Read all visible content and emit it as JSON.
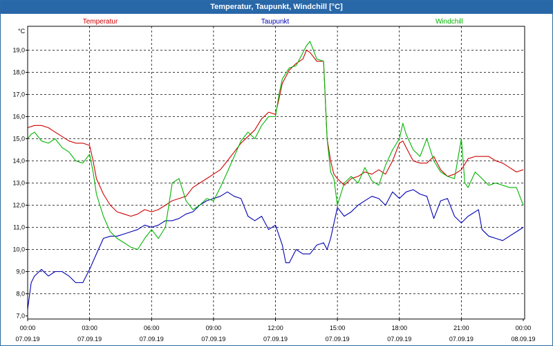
{
  "window": {
    "title": "Temperatur, Taupunkt, Windchill [°C]"
  },
  "chart_data": {
    "type": "line",
    "title": "Temperatur, Taupunkt, Windchill [°C]",
    "ylabel": "°C",
    "ylim": [
      7.0,
      19.5
    ],
    "xlim": [
      0,
      24
    ],
    "grid": true,
    "legend_position": "top",
    "y_ticks": [
      "7,0",
      "8,0",
      "9,0",
      "10,0",
      "11,0",
      "12,0",
      "13,0",
      "14,0",
      "15,0",
      "16,0",
      "17,0",
      "18,0",
      "19,0"
    ],
    "x_ticks": [
      {
        "t": "00:00",
        "d": "07.09.19"
      },
      {
        "t": "03:00",
        "d": "07.09.19"
      },
      {
        "t": "06:00",
        "d": "07.09.19"
      },
      {
        "t": "09:00",
        "d": "07.09.19"
      },
      {
        "t": "12:00",
        "d": "07.09.19"
      },
      {
        "t": "15:00",
        "d": "07.09.19"
      },
      {
        "t": "18:00",
        "d": "07.09.19"
      },
      {
        "t": "21:00",
        "d": "07.09.19"
      },
      {
        "t": "00:00",
        "d": "08.09.19"
      }
    ],
    "series": [
      {
        "name": "Temperatur",
        "color": "#cc0000",
        "points": [
          [
            0,
            15.5
          ],
          [
            0.33,
            15.6
          ],
          [
            0.67,
            15.6
          ],
          [
            1,
            15.5
          ],
          [
            1.33,
            15.3
          ],
          [
            1.67,
            15.1
          ],
          [
            2,
            14.9
          ],
          [
            2.33,
            14.8
          ],
          [
            2.67,
            14.8
          ],
          [
            3,
            14.7
          ],
          [
            3.17,
            14.0
          ],
          [
            3.33,
            13.2
          ],
          [
            3.67,
            12.5
          ],
          [
            4,
            12.0
          ],
          [
            4.33,
            11.7
          ],
          [
            4.67,
            11.6
          ],
          [
            5,
            11.5
          ],
          [
            5.33,
            11.6
          ],
          [
            5.67,
            11.8
          ],
          [
            6,
            11.7
          ],
          [
            6.33,
            11.8
          ],
          [
            6.67,
            12.0
          ],
          [
            7,
            12.2
          ],
          [
            7.33,
            12.3
          ],
          [
            7.67,
            12.4
          ],
          [
            8,
            12.8
          ],
          [
            8.33,
            13.0
          ],
          [
            8.67,
            13.2
          ],
          [
            9,
            13.4
          ],
          [
            9.33,
            13.6
          ],
          [
            9.67,
            14.0
          ],
          [
            10,
            14.4
          ],
          [
            10.33,
            14.8
          ],
          [
            10.67,
            15.1
          ],
          [
            11,
            15.4
          ],
          [
            11.33,
            15.9
          ],
          [
            11.67,
            16.2
          ],
          [
            12,
            16.1
          ],
          [
            12.17,
            16.8
          ],
          [
            12.33,
            17.5
          ],
          [
            12.67,
            18.1
          ],
          [
            13,
            18.4
          ],
          [
            13.33,
            18.6
          ],
          [
            13.5,
            19.0
          ],
          [
            13.67,
            18.9
          ],
          [
            14,
            18.5
          ],
          [
            14.33,
            18.5
          ],
          [
            14.5,
            15.0
          ],
          [
            14.67,
            14.0
          ],
          [
            14.83,
            13.4
          ],
          [
            15,
            13.2
          ],
          [
            15.33,
            12.9
          ],
          [
            15.67,
            13.2
          ],
          [
            16,
            13.3
          ],
          [
            16.33,
            13.5
          ],
          [
            16.67,
            13.4
          ],
          [
            17,
            13.6
          ],
          [
            17.33,
            13.4
          ],
          [
            17.67,
            14.0
          ],
          [
            18,
            14.8
          ],
          [
            18.17,
            14.9
          ],
          [
            18.33,
            14.6
          ],
          [
            18.67,
            14.0
          ],
          [
            19,
            13.9
          ],
          [
            19.33,
            13.9
          ],
          [
            19.67,
            14.2
          ],
          [
            20,
            13.6
          ],
          [
            20.33,
            13.3
          ],
          [
            20.67,
            13.4
          ],
          [
            21,
            13.6
          ],
          [
            21.33,
            14.1
          ],
          [
            21.67,
            14.2
          ],
          [
            22,
            14.2
          ],
          [
            22.33,
            14.2
          ],
          [
            22.67,
            14.0
          ],
          [
            23,
            13.9
          ],
          [
            23.33,
            13.7
          ],
          [
            23.67,
            13.5
          ],
          [
            24,
            13.6
          ]
        ]
      },
      {
        "name": "Taupunkt",
        "color": "#0000b4",
        "points": [
          [
            0,
            7.3
          ],
          [
            0.17,
            8.5
          ],
          [
            0.33,
            8.8
          ],
          [
            0.67,
            9.1
          ],
          [
            1,
            8.8
          ],
          [
            1.33,
            9.0
          ],
          [
            1.67,
            9.0
          ],
          [
            2,
            8.8
          ],
          [
            2.33,
            8.5
          ],
          [
            2.67,
            8.5
          ],
          [
            3,
            9.1
          ],
          [
            3.33,
            9.8
          ],
          [
            3.67,
            10.5
          ],
          [
            4,
            10.6
          ],
          [
            4.33,
            10.6
          ],
          [
            4.67,
            10.7
          ],
          [
            5,
            10.8
          ],
          [
            5.33,
            10.9
          ],
          [
            5.67,
            11.1
          ],
          [
            6,
            11.0
          ],
          [
            6.33,
            11.1
          ],
          [
            6.67,
            11.3
          ],
          [
            7,
            11.3
          ],
          [
            7.33,
            11.4
          ],
          [
            7.67,
            11.6
          ],
          [
            8,
            11.7
          ],
          [
            8.33,
            12.0
          ],
          [
            8.67,
            12.2
          ],
          [
            9,
            12.3
          ],
          [
            9.33,
            12.4
          ],
          [
            9.67,
            12.6
          ],
          [
            10,
            12.4
          ],
          [
            10.33,
            12.3
          ],
          [
            10.67,
            11.5
          ],
          [
            11,
            11.3
          ],
          [
            11.33,
            11.5
          ],
          [
            11.67,
            10.9
          ],
          [
            12,
            11.1
          ],
          [
            12.33,
            10.2
          ],
          [
            12.5,
            9.4
          ],
          [
            12.67,
            9.4
          ],
          [
            13,
            10.0
          ],
          [
            13.33,
            9.8
          ],
          [
            13.67,
            9.8
          ],
          [
            14,
            10.2
          ],
          [
            14.33,
            10.3
          ],
          [
            14.5,
            10.0
          ],
          [
            14.67,
            10.5
          ],
          [
            15,
            11.9
          ],
          [
            15.33,
            11.5
          ],
          [
            15.67,
            11.7
          ],
          [
            16,
            12.0
          ],
          [
            16.33,
            12.2
          ],
          [
            16.67,
            12.4
          ],
          [
            17,
            12.3
          ],
          [
            17.33,
            12.0
          ],
          [
            17.67,
            12.6
          ],
          [
            18,
            12.3
          ],
          [
            18.33,
            12.6
          ],
          [
            18.67,
            12.7
          ],
          [
            19,
            12.5
          ],
          [
            19.33,
            12.4
          ],
          [
            19.67,
            11.4
          ],
          [
            20,
            12.2
          ],
          [
            20.33,
            12.3
          ],
          [
            20.67,
            11.5
          ],
          [
            21,
            11.2
          ],
          [
            21.33,
            11.5
          ],
          [
            21.67,
            11.7
          ],
          [
            21.83,
            11.8
          ],
          [
            22,
            10.9
          ],
          [
            22.33,
            10.6
          ],
          [
            22.67,
            10.5
          ],
          [
            23,
            10.4
          ],
          [
            23.33,
            10.6
          ],
          [
            23.67,
            10.8
          ],
          [
            24,
            11.0
          ]
        ]
      },
      {
        "name": "Windchill",
        "color": "#00b400",
        "points": [
          [
            0,
            15.0
          ],
          [
            0.17,
            15.2
          ],
          [
            0.33,
            15.3
          ],
          [
            0.67,
            14.9
          ],
          [
            1,
            14.8
          ],
          [
            1.33,
            15.0
          ],
          [
            1.67,
            14.6
          ],
          [
            2,
            14.4
          ],
          [
            2.33,
            14.0
          ],
          [
            2.67,
            13.9
          ],
          [
            3,
            14.3
          ],
          [
            3.17,
            13.5
          ],
          [
            3.33,
            12.5
          ],
          [
            3.67,
            11.5
          ],
          [
            4,
            10.8
          ],
          [
            4.33,
            10.5
          ],
          [
            4.67,
            10.3
          ],
          [
            5,
            10.1
          ],
          [
            5.33,
            10.0
          ],
          [
            5.67,
            10.5
          ],
          [
            6,
            10.9
          ],
          [
            6.33,
            10.5
          ],
          [
            6.67,
            11.0
          ],
          [
            7,
            13.0
          ],
          [
            7.33,
            13.2
          ],
          [
            7.67,
            12.2
          ],
          [
            8,
            11.8
          ],
          [
            8.33,
            12.0
          ],
          [
            8.67,
            12.3
          ],
          [
            9,
            12.2
          ],
          [
            9.33,
            12.8
          ],
          [
            9.67,
            13.5
          ],
          [
            10,
            14.2
          ],
          [
            10.33,
            14.9
          ],
          [
            10.67,
            15.3
          ],
          [
            11,
            15.0
          ],
          [
            11.33,
            15.6
          ],
          [
            11.67,
            16.0
          ],
          [
            12,
            16.0
          ],
          [
            12.17,
            17.0
          ],
          [
            12.33,
            17.7
          ],
          [
            12.67,
            18.2
          ],
          [
            13,
            18.3
          ],
          [
            13.17,
            18.6
          ],
          [
            13.5,
            19.2
          ],
          [
            13.67,
            19.4
          ],
          [
            14,
            18.6
          ],
          [
            14.33,
            18.5
          ],
          [
            14.5,
            15.0
          ],
          [
            14.67,
            13.5
          ],
          [
            14.83,
            13.2
          ],
          [
            15,
            12.0
          ],
          [
            15.33,
            13.0
          ],
          [
            15.67,
            13.3
          ],
          [
            16,
            13.0
          ],
          [
            16.33,
            13.7
          ],
          [
            16.67,
            13.1
          ],
          [
            17,
            12.9
          ],
          [
            17.33,
            13.8
          ],
          [
            17.67,
            14.5
          ],
          [
            18,
            15.0
          ],
          [
            18.17,
            15.7
          ],
          [
            18.33,
            15.2
          ],
          [
            18.67,
            14.5
          ],
          [
            19,
            14.2
          ],
          [
            19.33,
            15.0
          ],
          [
            19.67,
            14.0
          ],
          [
            20,
            13.5
          ],
          [
            20.33,
            13.3
          ],
          [
            20.67,
            13.2
          ],
          [
            21,
            15.0
          ],
          [
            21.17,
            13.0
          ],
          [
            21.33,
            12.8
          ],
          [
            21.67,
            13.5
          ],
          [
            22,
            13.2
          ],
          [
            22.33,
            12.9
          ],
          [
            22.67,
            13.0
          ],
          [
            23,
            12.9
          ],
          [
            23.33,
            12.8
          ],
          [
            23.67,
            12.8
          ],
          [
            24,
            12.0
          ]
        ]
      }
    ]
  }
}
